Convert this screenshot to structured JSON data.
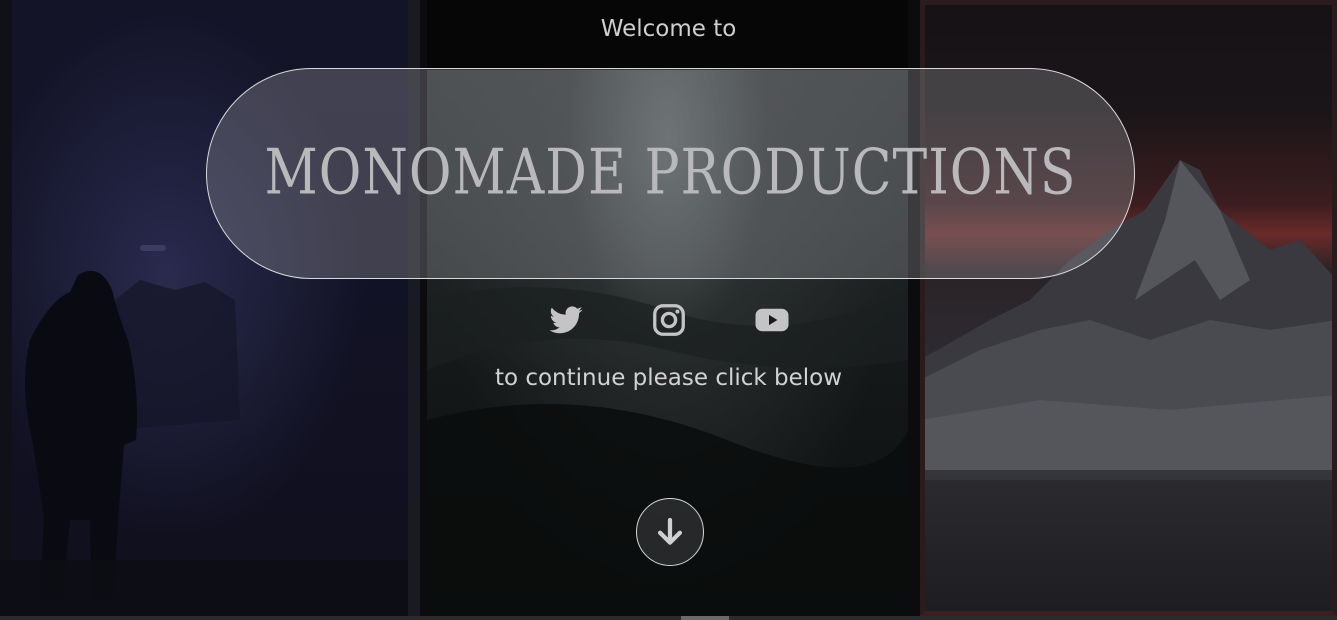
{
  "hero": {
    "welcome": "Welcome to",
    "brand_title": "MONOMADE PRODUCTIONS",
    "continue_text": "to continue please click below"
  },
  "socials": [
    {
      "name": "twitter",
      "icon": "twitter-icon"
    },
    {
      "name": "instagram",
      "icon": "instagram-icon"
    },
    {
      "name": "youtube",
      "icon": "youtube-icon"
    }
  ],
  "scroll_button": {
    "icon": "arrow-down-icon"
  },
  "colors": {
    "text": "#cfcfcf",
    "brand_text": "#b9b9bc",
    "pill_border": "#d9d9d9",
    "icon": "#c4c4c4",
    "sunset_red": "#6a2a2a"
  }
}
